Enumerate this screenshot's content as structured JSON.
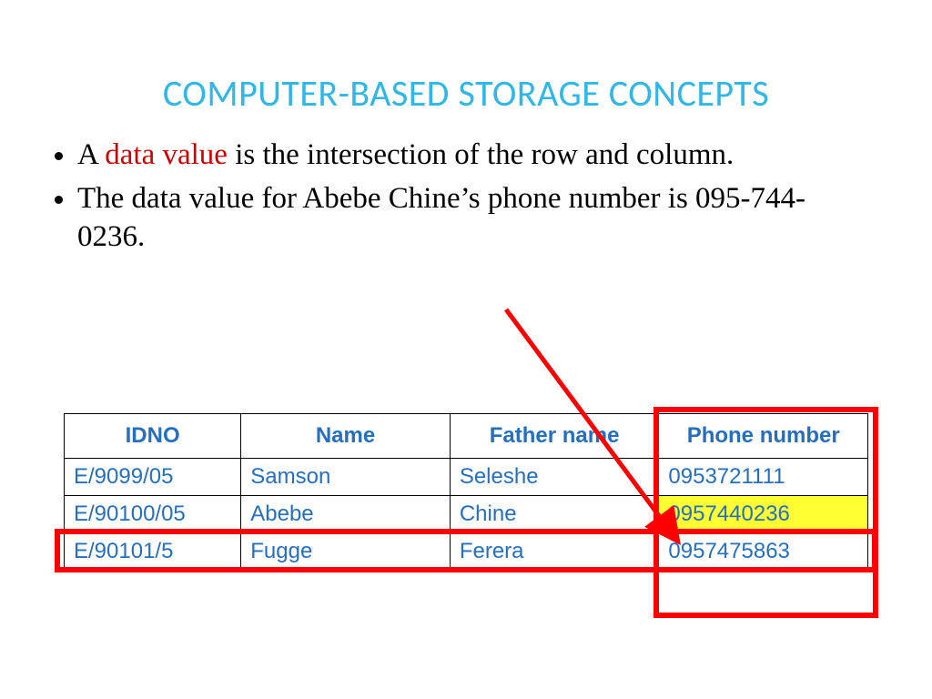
{
  "title": "COMPUTER-BASED STORAGE CONCEPTS",
  "bullets": {
    "b1_pre": "A ",
    "b1_red": "data value",
    "b1_post": " is the intersection of the row and column.",
    "b2": "The data value for Abebe Chine’s phone number is 095-744-0236."
  },
  "table": {
    "headers": {
      "h1": "IDNO",
      "h2": "Name",
      "h3": "Father name",
      "h4": "Phone number"
    },
    "rows": [
      {
        "idno": "E/9099/05",
        "name": "Samson",
        "father": "Seleshe",
        "phone": "0953721111"
      },
      {
        "idno": "E/90100/05",
        "name": "Abebe",
        "father": "Chine",
        "phone": "0957440236"
      },
      {
        "idno": "E/90101/5",
        "name": "Fugge",
        "father": "Ferera",
        "phone": "0957475863"
      }
    ]
  }
}
